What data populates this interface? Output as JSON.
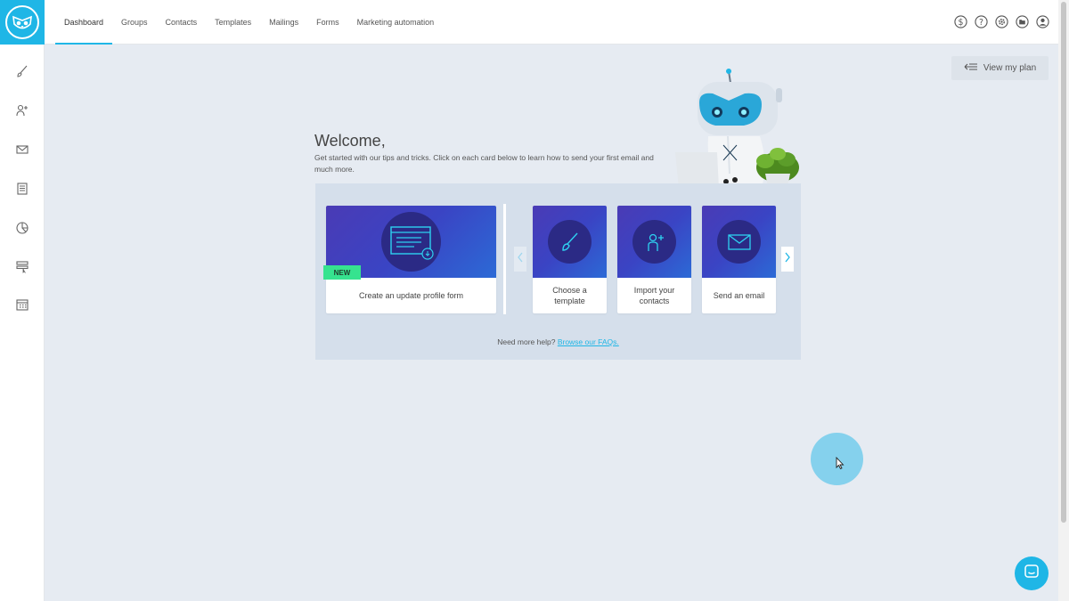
{
  "nav": {
    "items": [
      {
        "label": "Dashboard",
        "active": true
      },
      {
        "label": "Groups"
      },
      {
        "label": "Contacts"
      },
      {
        "label": "Templates"
      },
      {
        "label": "Mailings"
      },
      {
        "label": "Forms"
      },
      {
        "label": "Marketing automation"
      }
    ],
    "right_icons": [
      "dollar-icon",
      "help-icon",
      "gear-icon",
      "folder-icon",
      "user-icon"
    ]
  },
  "sidebar": {
    "items": [
      "brush-icon",
      "add-user-icon",
      "envelope-icon",
      "document-icon",
      "pie-chart-icon",
      "form-icon",
      "calendar-icon"
    ]
  },
  "view_plan": {
    "label": "View my plan",
    "icon": "list-arrow-icon"
  },
  "welcome": {
    "title": "Welcome,",
    "text": "Get started with our tips and tricks. Click on each card below to learn how to send your first email and much more."
  },
  "cards": [
    {
      "label": "Create an update profile form",
      "badge": "NEW",
      "icon": "form-window-icon"
    },
    {
      "label_line1": "Choose a",
      "label_line2": "template",
      "icon": "brush-icon"
    },
    {
      "label_line1": "Import your",
      "label_line2": "contacts",
      "icon": "add-user-icon"
    },
    {
      "label": "Send an email",
      "icon": "envelope-icon"
    }
  ],
  "help": {
    "text": "Need more help?",
    "link": "Browse our FAQs."
  },
  "colors": {
    "accent": "#1fb6e6",
    "badge": "#36e38f",
    "panel": "#d5dfeb",
    "background": "#e6ebf2"
  }
}
